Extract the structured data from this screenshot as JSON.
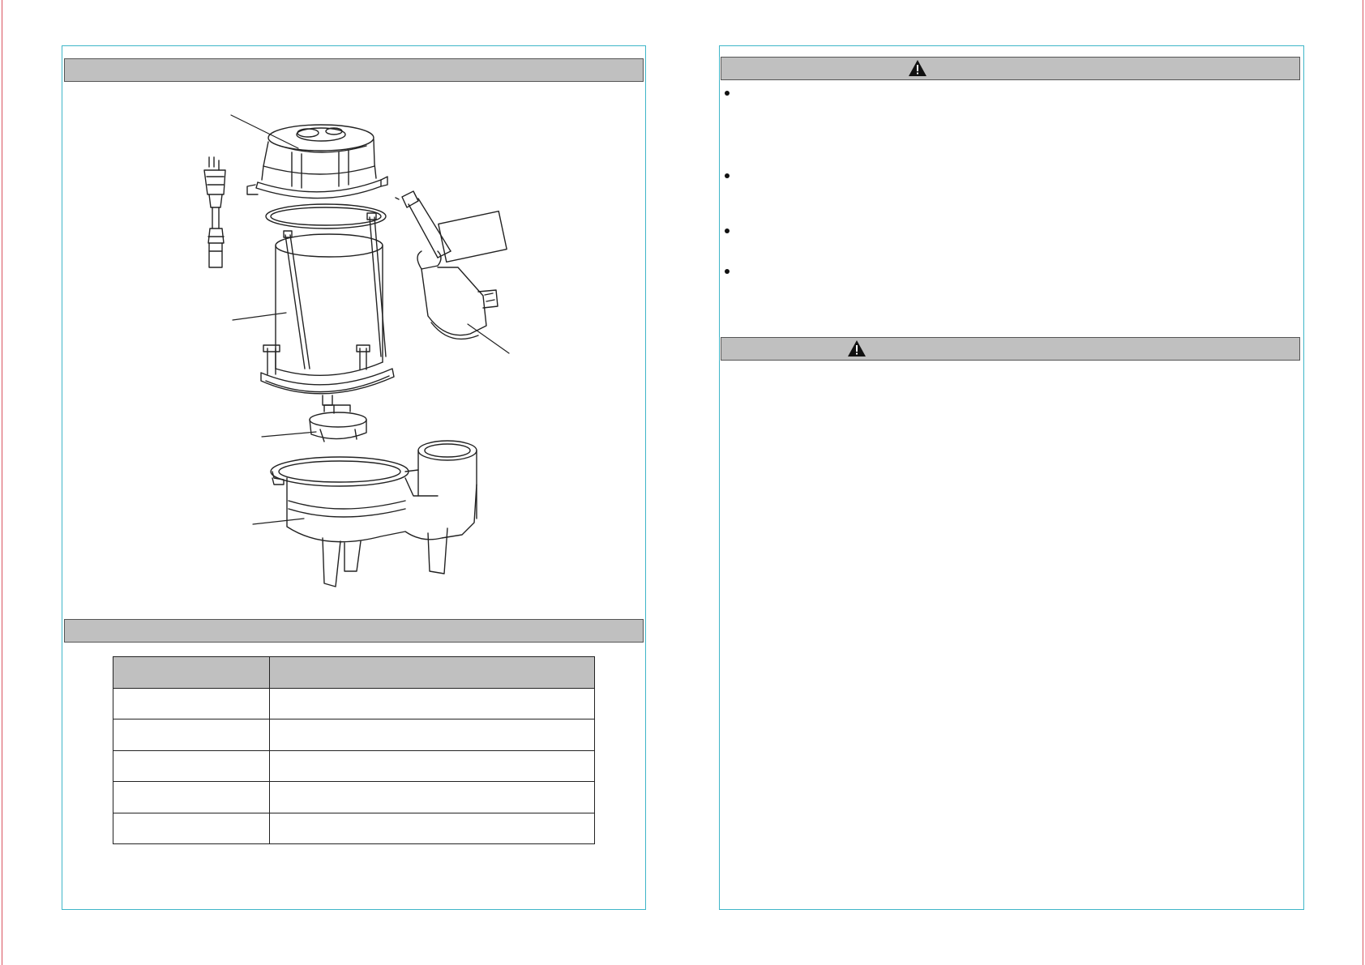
{
  "left_page": {
    "diagram_title": "",
    "specifications_title": "",
    "spec_table": {
      "headers": [
        "",
        ""
      ],
      "rows": [
        [
          "",
          ""
        ],
        [
          "",
          ""
        ],
        [
          "",
          ""
        ],
        [
          "",
          ""
        ],
        [
          "",
          ""
        ]
      ]
    }
  },
  "right_page": {
    "warning_bar_1": {
      "icon": "warning-triangle-icon",
      "label": ""
    },
    "warning_bar_2": {
      "icon": "warning-triangle-icon",
      "label": ""
    },
    "bullets": [
      "",
      "",
      "",
      ""
    ]
  },
  "colors": {
    "panel_border": "#3fb6c8",
    "page_edge": "#d9535f",
    "header_fill": "#c0c0c0"
  }
}
